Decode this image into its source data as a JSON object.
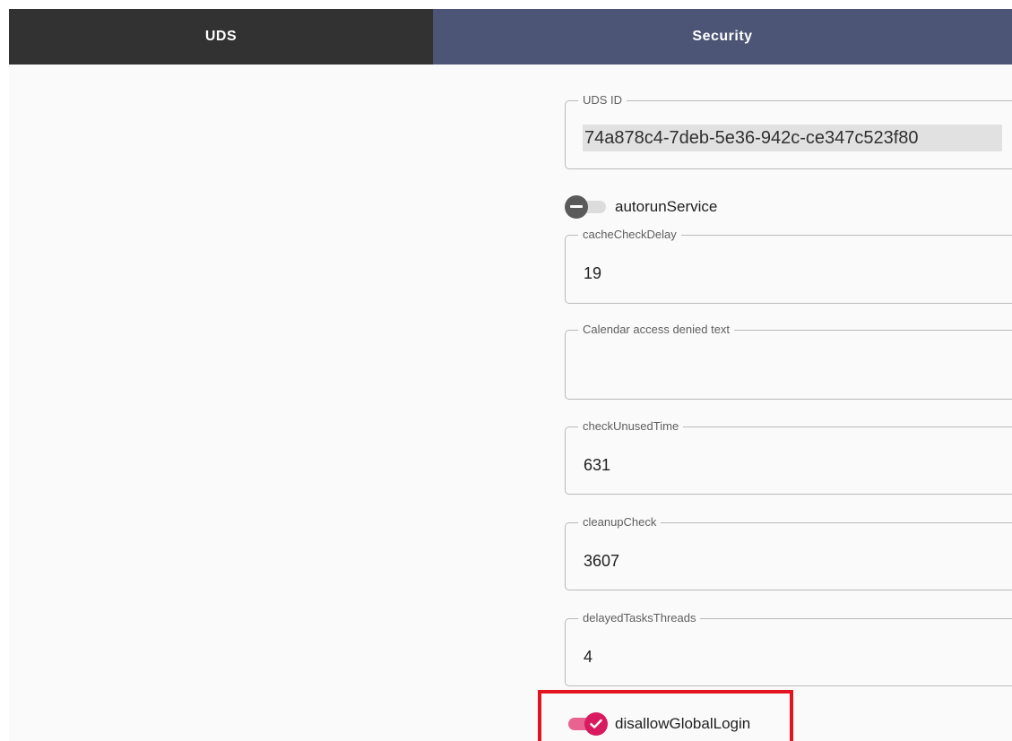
{
  "tabs": [
    {
      "label": "UDS"
    },
    {
      "label": "Security"
    }
  ],
  "uds_id": {
    "label": "UDS ID",
    "value": "74a878c4-7deb-5e36-942c-ce347c523f80"
  },
  "autorun_service": {
    "label": "autorunService",
    "state": "off",
    "icon": "minus-icon"
  },
  "cache_check_delay": {
    "label": "cacheCheckDelay",
    "value": "19"
  },
  "calendar_access_denied_text": {
    "label": "Calendar access denied text",
    "value": ""
  },
  "check_unused_time": {
    "label": "checkUnusedTime",
    "value": "631"
  },
  "cleanup_check": {
    "label": "cleanupCheck",
    "value": "3607"
  },
  "delayed_tasks_threads": {
    "label": "delayedTasksThreads",
    "value": "4"
  },
  "disallow_global_login": {
    "label": "disallowGlobalLogin",
    "state": "on",
    "icon": "check-icon"
  },
  "colors": {
    "tab_uds": "#323232",
    "tab_security": "#4d5576",
    "toggle_on": "#d81b60",
    "highlight": "#e3131f"
  }
}
